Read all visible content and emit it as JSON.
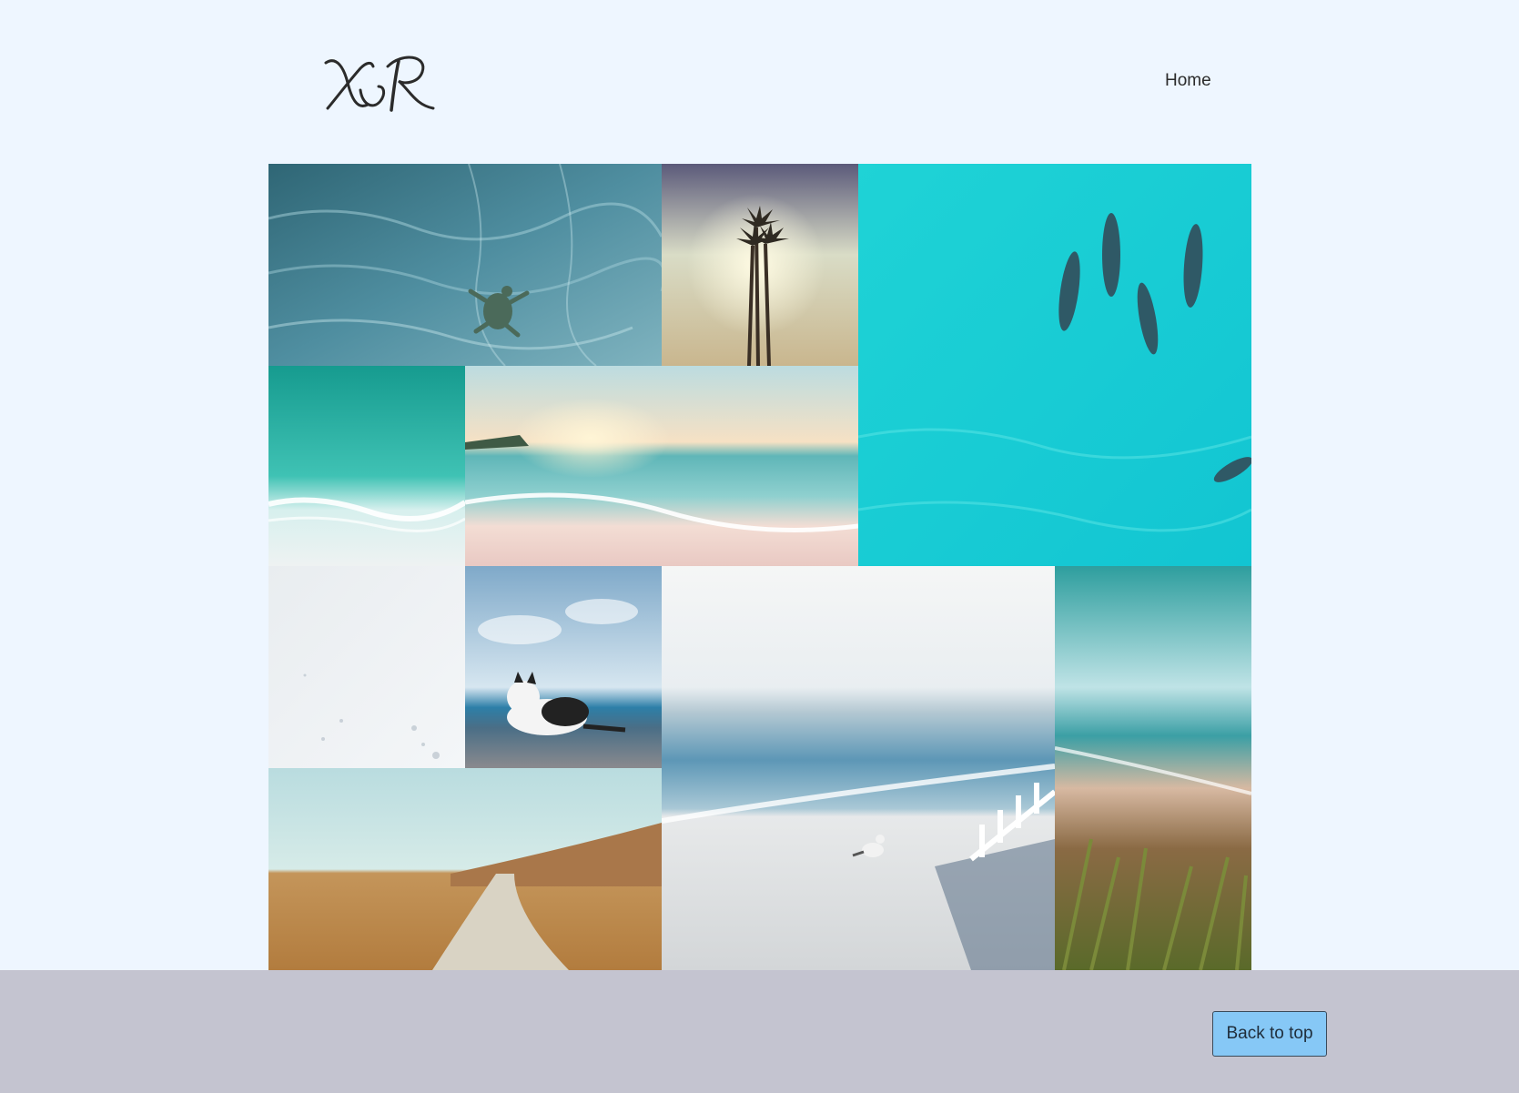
{
  "header": {
    "logo_text": "XvR",
    "nav": [
      {
        "label": "Home"
      }
    ]
  },
  "gallery": {
    "tiles": [
      {
        "name": "sea-turtle-photo",
        "subject": "sea turtle in blue water"
      },
      {
        "name": "palm-trees-sunset-photo",
        "subject": "palm trees at sunset"
      },
      {
        "name": "dolphins-photo",
        "subject": "dolphins in turquoise sea"
      },
      {
        "name": "aerial-waves-photo",
        "subject": "aerial waves on shore"
      },
      {
        "name": "beach-sunset-photo",
        "subject": "beach at sunset"
      },
      {
        "name": "white-sand-photo",
        "subject": "white sand"
      },
      {
        "name": "cat-by-sea-photo",
        "subject": "cat by the sea"
      },
      {
        "name": "seagull-beach-photo",
        "subject": "seagull on the beach"
      },
      {
        "name": "coastal-cliff-photo",
        "subject": "coastline with grass"
      },
      {
        "name": "dirt-path-hills-photo",
        "subject": "path through dry hills"
      }
    ]
  },
  "footer": {
    "back_to_top_label": "Back to top"
  },
  "colors": {
    "page_background": "#eef6ff",
    "footer_background": "#c4c4d0",
    "button_background": "#86c8f6"
  }
}
